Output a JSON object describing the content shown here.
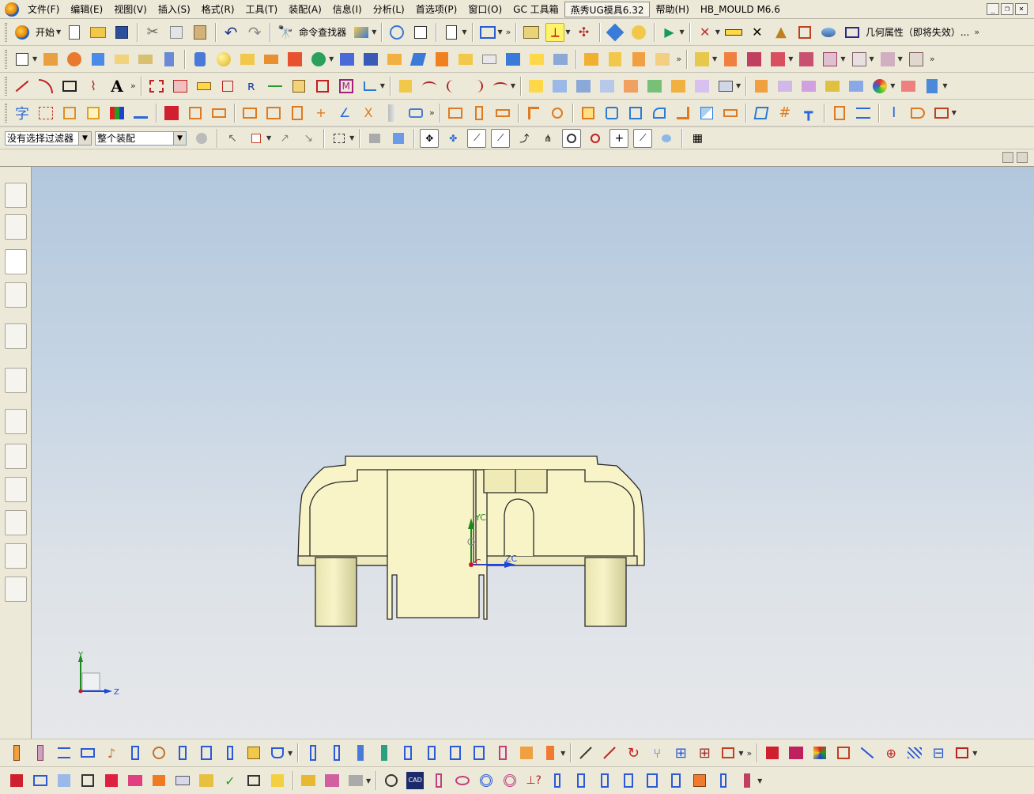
{
  "menubar": {
    "items": [
      "文件(F)",
      "编辑(E)",
      "视图(V)",
      "插入(S)",
      "格式(R)",
      "工具(T)",
      "装配(A)",
      "信息(I)",
      "分析(L)",
      "首选项(P)",
      "窗口(O)",
      "GC 工具箱",
      "燕秀UG模具6.32",
      "帮助(H)",
      "HB_MOULD M6.6"
    ],
    "window_buttons": [
      "_",
      "❐",
      "×"
    ]
  },
  "toolbar1": {
    "start_label": "开始",
    "command_finder_label": "命令查找器",
    "geometry_property_label": "几何属性（即将失效）..."
  },
  "selection_bar": {
    "filter_value": "没有选择过滤器",
    "scope_value": "整个装配"
  },
  "viewport": {
    "wcs_labels": {
      "yc": "YC",
      "zc": "ZC",
      "xc": "C"
    },
    "triad_labels": {
      "y": "Y",
      "z": "Z"
    },
    "colors": {
      "part_fill": "#f8f4c8",
      "part_edge": "#2a2a2a",
      "axis_y": "#1e8a1e",
      "axis_z": "#1d45d8",
      "axis_x": "#d01818"
    }
  }
}
